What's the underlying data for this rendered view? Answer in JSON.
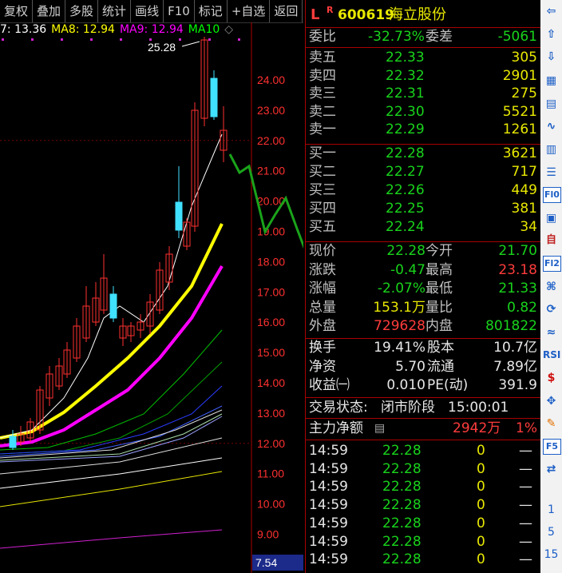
{
  "toolbar": {
    "buttons": [
      "复权",
      "叠加",
      "多股",
      "统计",
      "画线",
      "F10",
      "标记",
      "+自选",
      "返回"
    ]
  },
  "ma_legend": [
    {
      "text": "7: 13.36",
      "color": "#ffffff"
    },
    {
      "text": "MA8: 12.94",
      "color": "#ffff00"
    },
    {
      "text": "MA9: 12.94",
      "color": "#ff00ff"
    },
    {
      "text": "MA10",
      "color": "#00ff00"
    }
  ],
  "chart": {
    "high_marker": "25.28",
    "price_labels": [
      "24.00",
      "23.00",
      "22.00",
      "21.00",
      "20.00",
      "19.00",
      "18.00",
      "17.00",
      "16.00",
      "15.00",
      "14.00",
      "13.00",
      "12.00",
      "11.00",
      "10.00",
      "9.00"
    ],
    "bottom_value": "7.54"
  },
  "quote": {
    "header": {
      "flag": "L",
      "sup": "R",
      "code": "600619",
      "name": "海立股份"
    },
    "weibi": {
      "label": "委比",
      "value": "-32.73%",
      "label2": "委差",
      "value2": "-5061"
    },
    "sell": [
      {
        "label": "卖五",
        "price": "22.33",
        "vol": "305"
      },
      {
        "label": "卖四",
        "price": "22.32",
        "vol": "2901"
      },
      {
        "label": "卖三",
        "price": "22.31",
        "vol": "275"
      },
      {
        "label": "卖二",
        "price": "22.30",
        "vol": "5521"
      },
      {
        "label": "卖一",
        "price": "22.29",
        "vol": "1261"
      }
    ],
    "buy": [
      {
        "label": "买一",
        "price": "22.28",
        "vol": "3621"
      },
      {
        "label": "买二",
        "price": "22.27",
        "vol": "717"
      },
      {
        "label": "买三",
        "price": "22.26",
        "vol": "449"
      },
      {
        "label": "买四",
        "price": "22.25",
        "vol": "381"
      },
      {
        "label": "买五",
        "price": "22.24",
        "vol": "34"
      }
    ],
    "stats": [
      {
        "l1": "现价",
        "v1": "22.28",
        "c1": "green",
        "l2": "今开",
        "v2": "21.70",
        "c2": "green"
      },
      {
        "l1": "涨跌",
        "v1": "-0.47",
        "c1": "green",
        "l2": "最高",
        "v2": "23.18",
        "c2": "red"
      },
      {
        "l1": "涨幅",
        "v1": "-2.07%",
        "c1": "green",
        "l2": "最低",
        "v2": "21.33",
        "c2": "green"
      },
      {
        "l1": "总量",
        "v1": "153.1万",
        "c1": "yellow",
        "l2": "量比",
        "v2": "0.82",
        "c2": "green"
      },
      {
        "l1": "外盘",
        "v1": "729628",
        "c1": "red",
        "l2": "内盘",
        "v2": "801822",
        "c2": "green"
      }
    ],
    "fund": [
      {
        "l1": "换手",
        "v1": "19.41%",
        "l2": "股本",
        "v2": "10.7亿"
      },
      {
        "l1": "净资",
        "v1": "5.70",
        "l2": "流通",
        "v2": "7.89亿"
      },
      {
        "l1": "收益㈠",
        "v1": "0.010",
        "l2": "PE(动)",
        "v2": "391.9"
      }
    ],
    "status": {
      "label": "交易状态:",
      "value": "闭市阶段",
      "time": "15:00:01"
    },
    "main_flow": {
      "label": "主力净额",
      "value": "2942万",
      "pct": "1%"
    },
    "ticks": [
      {
        "time": "14:59",
        "price": "22.28",
        "vol": "0",
        "dir": "—"
      },
      {
        "time": "14:59",
        "price": "22.28",
        "vol": "0",
        "dir": "—"
      },
      {
        "time": "14:59",
        "price": "22.28",
        "vol": "0",
        "dir": "—"
      },
      {
        "time": "14:59",
        "price": "22.28",
        "vol": "0",
        "dir": "—"
      },
      {
        "time": "14:59",
        "price": "22.28",
        "vol": "0",
        "dir": "—"
      },
      {
        "time": "14:59",
        "price": "22.28",
        "vol": "0",
        "dir": "—"
      },
      {
        "time": "14:59",
        "price": "22.28",
        "vol": "0",
        "dir": "—"
      }
    ]
  },
  "sidebar": {
    "icons": [
      "left-arrow-icon",
      "up-arrow-icon",
      "down-arrow-icon",
      "report-icon",
      "grid-icon",
      "line-chart-icon",
      "candlestick-icon",
      "list-icon",
      "f10-icon",
      "news-icon",
      "self-icon",
      "f12-icon",
      "analysis-icon",
      "refresh-icon",
      "wave-icon",
      "rsi-icon",
      "dollar-icon",
      "move-icon",
      "pen-icon",
      "f5-icon",
      "switch-icon"
    ],
    "labels": [
      "Fl0",
      "自",
      "Fl2",
      "RSI",
      "F5",
      "1",
      "5",
      "15"
    ]
  }
}
